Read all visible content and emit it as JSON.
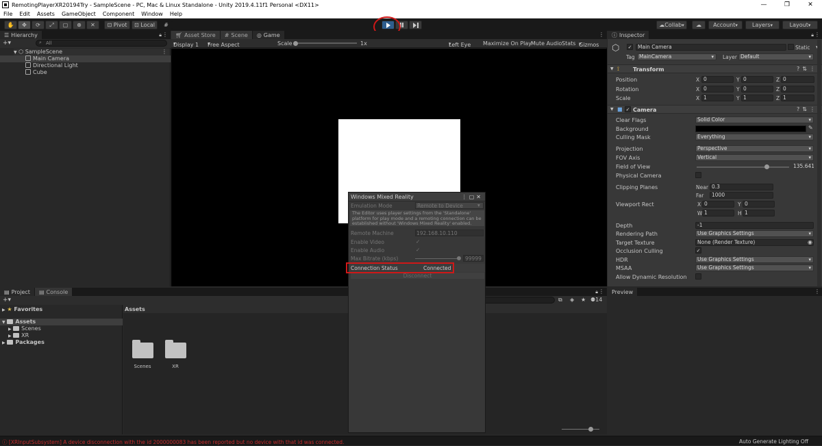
{
  "window": {
    "title": "RemotingPlayerXR20194Try - SampleScene - PC, Mac & Linux Standalone - Unity 2019.4.11f1 Personal <DX11>",
    "controls": [
      "—",
      "❐",
      "✕"
    ]
  },
  "menu": [
    "File",
    "Edit",
    "Assets",
    "GameObject",
    "Component",
    "Window",
    "Help"
  ],
  "toolbar": {
    "pivot": "Pivot",
    "local": "Local",
    "collab": "Collab",
    "account": "Account",
    "layers": "Layers",
    "layout": "Layout",
    "play_active": true
  },
  "hierarchy": {
    "tab": "Hierarchy",
    "search_placeholder": "All",
    "scene": "SampleScene",
    "items": [
      "Main Camera",
      "Directional Light",
      "Cube"
    ]
  },
  "center_tabs": [
    "Asset Store",
    "Scene",
    "Game"
  ],
  "game_bar": {
    "display": "Display 1",
    "aspect": "Free Aspect",
    "scale_label": "Scale",
    "scale_value": "1x",
    "eye": "Left Eye",
    "maximize": "Maximize On Play",
    "mute": "Mute Audio",
    "stats": "Stats",
    "gizmos": "Gizmos"
  },
  "wmr": {
    "title": "Windows Mixed Reality",
    "emulation_label": "Emulation Mode",
    "emulation_value": "Remote to Device",
    "help": "The Editor uses player settings from the 'Standalone' platform for play mode and a remoting connection can be established without 'Windows Mixed Reality' enabled.",
    "remote_label": "Remote Machine",
    "remote_value": "192.168.10.110",
    "video_label": "Enable Video",
    "audio_label": "Enable Audio",
    "bitrate_label": "Max Bitrate (kbps)",
    "bitrate_value": "99999",
    "status_label": "Connection Status",
    "status_value": "Connected",
    "disconnect": "Disconnect"
  },
  "inspector": {
    "tab": "Inspector",
    "object_name": "Main Camera",
    "static_label": "Static",
    "tag_label": "Tag",
    "tag_value": "MainCamera",
    "layer_label": "Layer",
    "layer_value": "Default",
    "transform": {
      "title": "Transform",
      "rows": [
        {
          "label": "Position",
          "x": "0",
          "y": "0",
          "z": "0"
        },
        {
          "label": "Rotation",
          "x": "0",
          "y": "0",
          "z": "0"
        },
        {
          "label": "Scale",
          "x": "1",
          "y": "1",
          "z": "1"
        }
      ]
    },
    "camera": {
      "title": "Camera",
      "clear_flags_label": "Clear Flags",
      "clear_flags": "Solid Color",
      "background_label": "Background",
      "background_color": "#000000",
      "culling_label": "Culling Mask",
      "culling": "Everything",
      "projection_label": "Projection",
      "projection": "Perspective",
      "fov_axis_label": "FOV Axis",
      "fov_axis": "Vertical",
      "fov_label": "Field of View",
      "fov": "135.641",
      "physical_label": "Physical Camera",
      "clipping_label": "Clipping Planes",
      "near_label": "Near",
      "near": "0.3",
      "far_label": "Far",
      "far": "1000",
      "viewport_label": "Viewport Rect",
      "vx": "0",
      "vy": "0",
      "vw": "1",
      "vh": "1",
      "depth_label": "Depth",
      "depth": "-1",
      "rendering_label": "Rendering Path",
      "rendering": "Use Graphics Settings",
      "target_label": "Target Texture",
      "target": "None (Render Texture)",
      "occlusion_label": "Occlusion Culling",
      "hdr_label": "HDR",
      "hdr": "Use Graphics Settings",
      "msaa_label": "MSAA",
      "msaa": "Use Graphics Settings",
      "dynres_label": "Allow Dynamic Resolution"
    }
  },
  "bottom_tabs": [
    "Project",
    "Console"
  ],
  "project": {
    "favorites": "Favorites",
    "assets": "Assets",
    "tree_children": [
      "Scenes",
      "XR"
    ],
    "packages": "Packages",
    "breadcrumb": "Assets",
    "folders": [
      "Scenes",
      "XR"
    ],
    "count": "14"
  },
  "preview": {
    "tab": "Preview"
  },
  "status": {
    "error": "[XRInputSubsystem] A device disconnection with the id 2000000083 has been reported but no device with that id was connected.",
    "lighting": "Auto Generate Lighting Off"
  }
}
